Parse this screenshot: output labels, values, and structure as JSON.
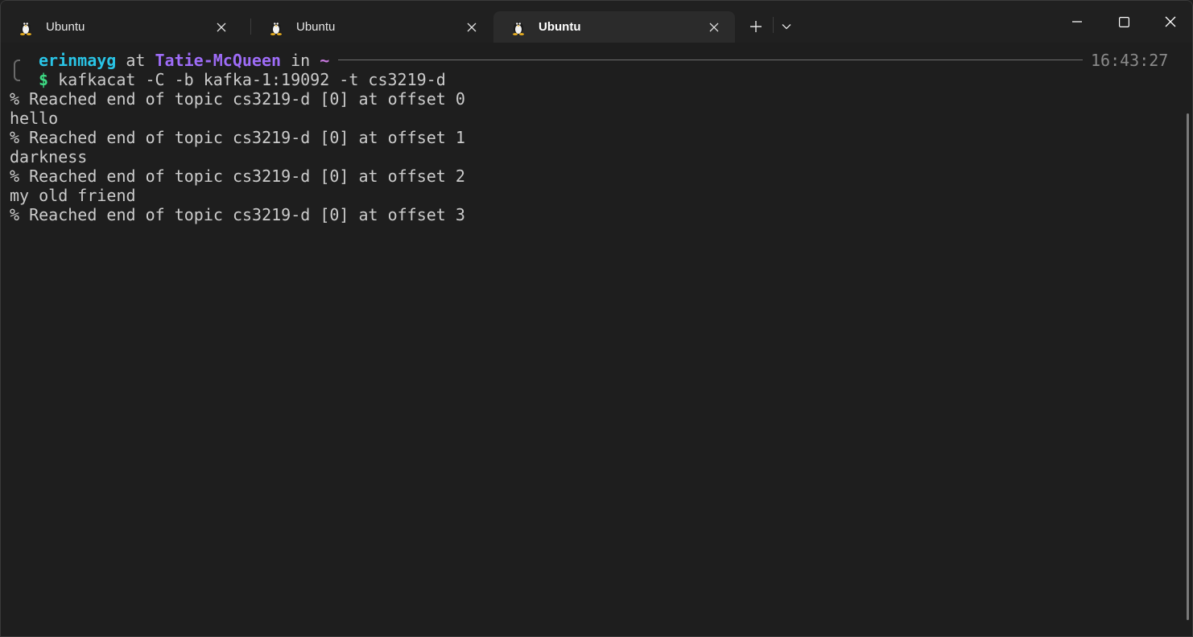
{
  "tabs": [
    {
      "label": "Ubuntu",
      "icon": "tux-icon",
      "active": false
    },
    {
      "label": "Ubuntu",
      "icon": "tux-icon",
      "active": false
    },
    {
      "label": "Ubuntu",
      "icon": "tux-icon",
      "active": true
    }
  ],
  "prompt": {
    "user": "erinmayg",
    "at": "at",
    "host": "Tatie-McQueen",
    "in": "in",
    "dir": "~",
    "time": "16:43:27",
    "dollar": "$",
    "command": "kafkacat -C -b kafka-1:19092 -t cs3219-d"
  },
  "output": [
    "% Reached end of topic cs3219-d [0] at offset 0",
    "hello",
    "% Reached end of topic cs3219-d [0] at offset 1",
    "darkness",
    "% Reached end of topic cs3219-d [0] at offset 2",
    "my old friend",
    "% Reached end of topic cs3219-d [0] at offset 3"
  ],
  "colors": {
    "user": "#29c4e6",
    "host": "#9e6cf7",
    "dir": "#c678dd",
    "dollar": "#3ddc84",
    "text": "#cccccc",
    "background": "#1e1e1e"
  }
}
